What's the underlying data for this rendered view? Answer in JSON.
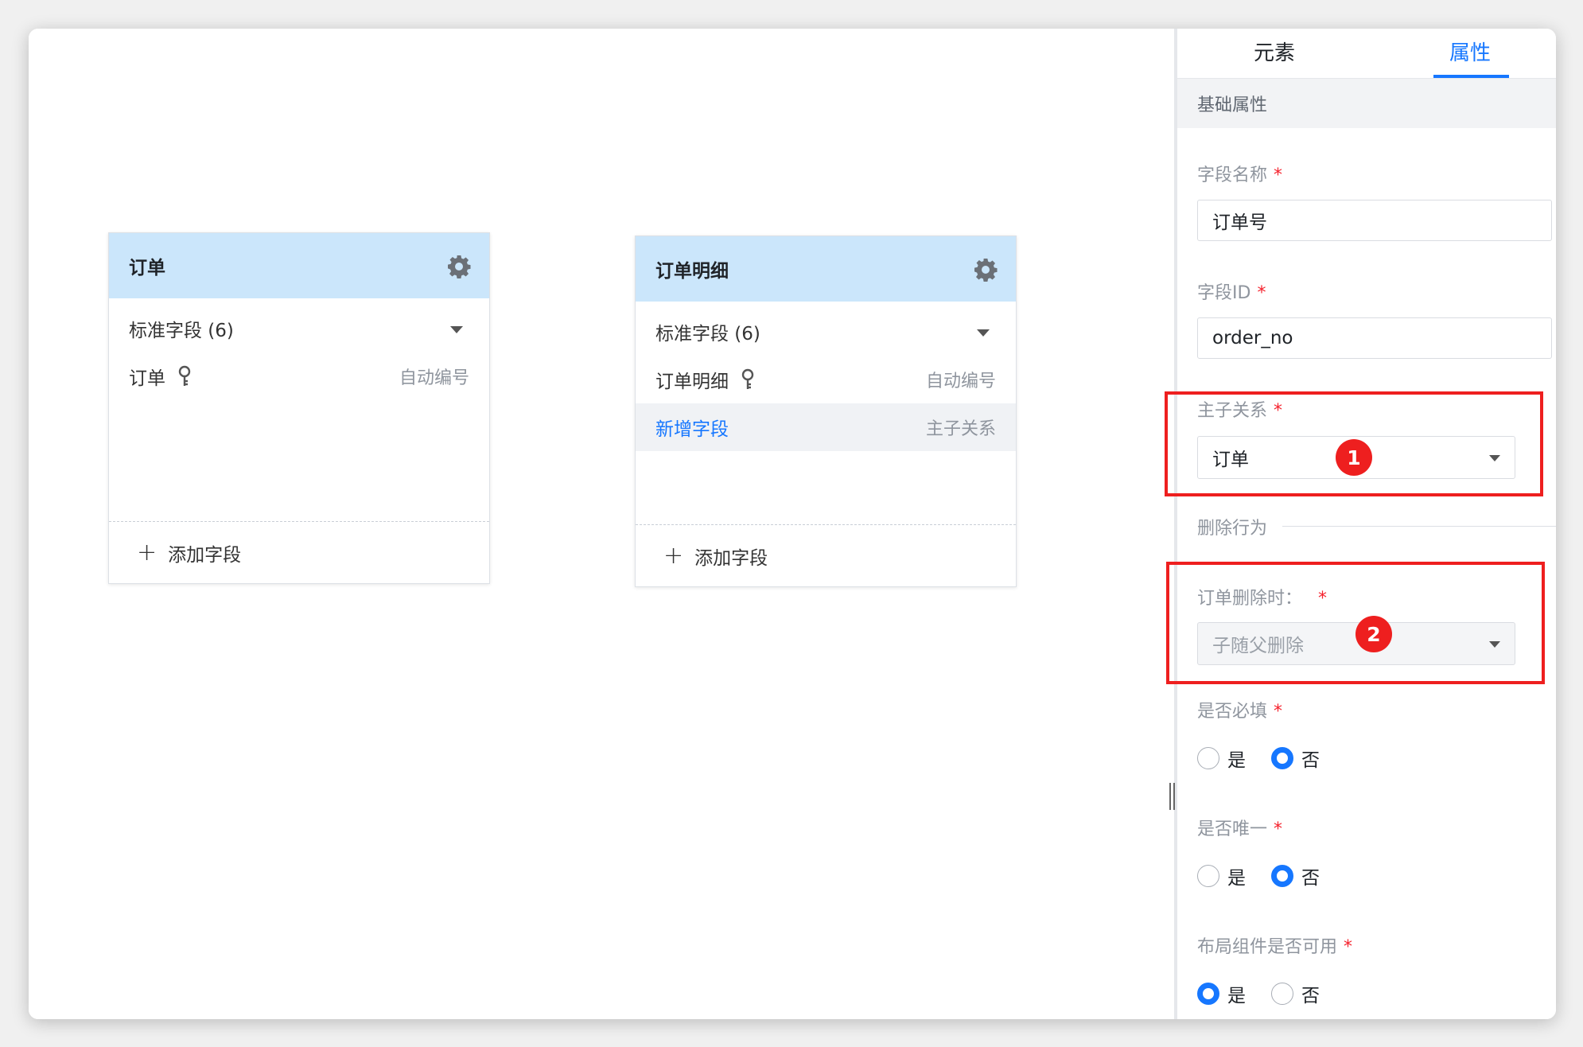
{
  "canvas": {
    "entities": [
      {
        "title": "订单",
        "group_label": "标准字段 (6)",
        "fields": [
          {
            "name": "订单",
            "type": "自动编号",
            "is_key": true
          }
        ],
        "add_field_label": "添加字段"
      },
      {
        "title": "订单明细",
        "group_label": "标准字段 (6)",
        "fields": [
          {
            "name": "订单明细",
            "type": "自动编号",
            "is_key": true
          },
          {
            "name": "新增字段",
            "type": "主子关系",
            "is_key": false
          }
        ],
        "add_field_label": "添加字段"
      }
    ]
  },
  "panel": {
    "tabs": [
      {
        "label": "元素",
        "active": false
      },
      {
        "label": "属性",
        "active": true
      }
    ],
    "section_title": "基础属性",
    "field_name": {
      "label": "字段名称",
      "required_mark": "*",
      "value": "订单号"
    },
    "field_id": {
      "label": "字段ID",
      "required_mark": "*",
      "value": "order_no"
    },
    "relation": {
      "label": "主子关系",
      "required_mark": "*",
      "value": "订单"
    },
    "delete_behavior": {
      "label": "删除行为"
    },
    "on_delete": {
      "label": "订单删除时：",
      "required_mark": "*",
      "value": "子随父删除"
    },
    "required": {
      "label": "是否必填",
      "required_mark": "*",
      "options": [
        "是",
        "否"
      ],
      "selected": "否"
    },
    "unique": {
      "label": "是否唯一",
      "required_mark": "*",
      "options": [
        "是",
        "否"
      ],
      "selected": "否"
    },
    "layout_usable": {
      "label": "布局组件是否可用",
      "required_mark": "*",
      "options": [
        "是",
        "否"
      ],
      "selected": "是"
    }
  },
  "annotations": [
    {
      "number": "1",
      "color": "#ee1f1f"
    },
    {
      "number": "2",
      "color": "#ee1f1f"
    }
  ],
  "colors": {
    "accent": "#1677ff",
    "entity_header": "#cbe6fb",
    "annotation": "#ee1f1f"
  }
}
